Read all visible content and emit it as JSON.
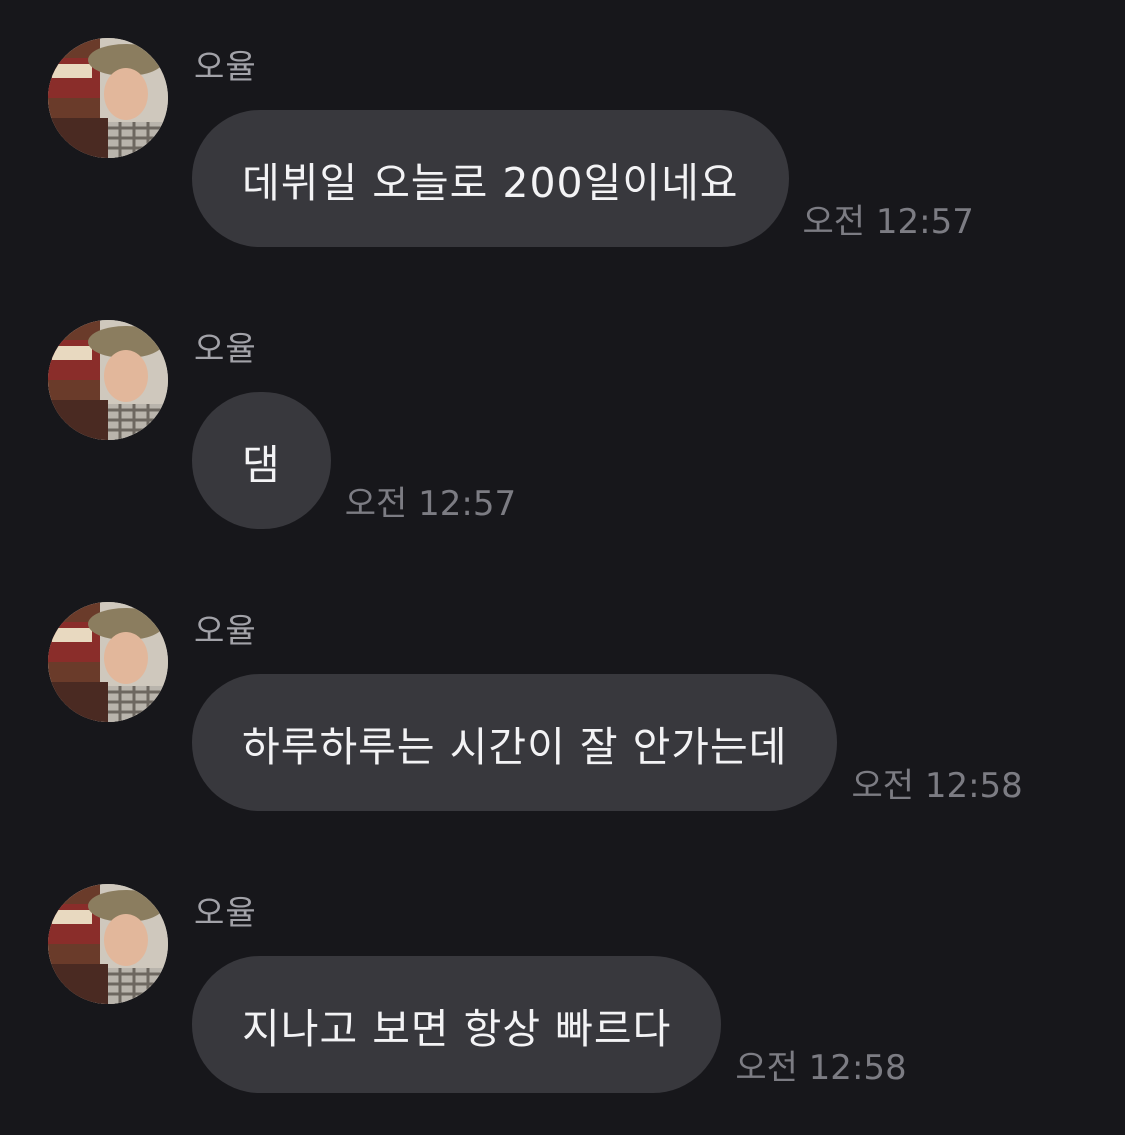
{
  "messages": [
    {
      "sender": "오율",
      "text": "데뷔일 오늘로 200일이네요",
      "time": "오전 12:57"
    },
    {
      "sender": "오율",
      "text": "댐",
      "time": "오전 12:57"
    },
    {
      "sender": "오율",
      "text": "하루하루는 시간이 잘 안가는데",
      "time": "오전 12:58"
    },
    {
      "sender": "오율",
      "text": "지나고 보면 항상 빠르다",
      "time": "오전 12:58"
    }
  ],
  "colors": {
    "background": "#17171b",
    "bubble": "#38383d",
    "sender_name": "#a2a2a8",
    "timestamp": "#7c7c83"
  },
  "icons": {
    "avatar": "profile-photo"
  }
}
